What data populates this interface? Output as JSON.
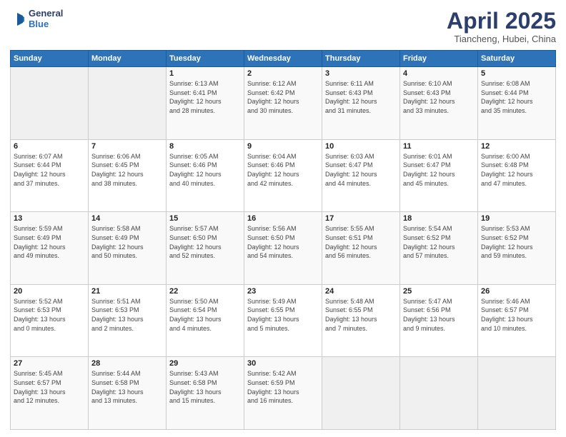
{
  "header": {
    "logo_line1": "General",
    "logo_line2": "Blue",
    "month": "April 2025",
    "location": "Tiancheng, Hubei, China"
  },
  "weekdays": [
    "Sunday",
    "Monday",
    "Tuesday",
    "Wednesday",
    "Thursday",
    "Friday",
    "Saturday"
  ],
  "weeks": [
    [
      {
        "day": "",
        "info": ""
      },
      {
        "day": "",
        "info": ""
      },
      {
        "day": "1",
        "info": "Sunrise: 6:13 AM\nSunset: 6:41 PM\nDaylight: 12 hours\nand 28 minutes."
      },
      {
        "day": "2",
        "info": "Sunrise: 6:12 AM\nSunset: 6:42 PM\nDaylight: 12 hours\nand 30 minutes."
      },
      {
        "day": "3",
        "info": "Sunrise: 6:11 AM\nSunset: 6:43 PM\nDaylight: 12 hours\nand 31 minutes."
      },
      {
        "day": "4",
        "info": "Sunrise: 6:10 AM\nSunset: 6:43 PM\nDaylight: 12 hours\nand 33 minutes."
      },
      {
        "day": "5",
        "info": "Sunrise: 6:08 AM\nSunset: 6:44 PM\nDaylight: 12 hours\nand 35 minutes."
      }
    ],
    [
      {
        "day": "6",
        "info": "Sunrise: 6:07 AM\nSunset: 6:44 PM\nDaylight: 12 hours\nand 37 minutes."
      },
      {
        "day": "7",
        "info": "Sunrise: 6:06 AM\nSunset: 6:45 PM\nDaylight: 12 hours\nand 38 minutes."
      },
      {
        "day": "8",
        "info": "Sunrise: 6:05 AM\nSunset: 6:46 PM\nDaylight: 12 hours\nand 40 minutes."
      },
      {
        "day": "9",
        "info": "Sunrise: 6:04 AM\nSunset: 6:46 PM\nDaylight: 12 hours\nand 42 minutes."
      },
      {
        "day": "10",
        "info": "Sunrise: 6:03 AM\nSunset: 6:47 PM\nDaylight: 12 hours\nand 44 minutes."
      },
      {
        "day": "11",
        "info": "Sunrise: 6:01 AM\nSunset: 6:47 PM\nDaylight: 12 hours\nand 45 minutes."
      },
      {
        "day": "12",
        "info": "Sunrise: 6:00 AM\nSunset: 6:48 PM\nDaylight: 12 hours\nand 47 minutes."
      }
    ],
    [
      {
        "day": "13",
        "info": "Sunrise: 5:59 AM\nSunset: 6:49 PM\nDaylight: 12 hours\nand 49 minutes."
      },
      {
        "day": "14",
        "info": "Sunrise: 5:58 AM\nSunset: 6:49 PM\nDaylight: 12 hours\nand 50 minutes."
      },
      {
        "day": "15",
        "info": "Sunrise: 5:57 AM\nSunset: 6:50 PM\nDaylight: 12 hours\nand 52 minutes."
      },
      {
        "day": "16",
        "info": "Sunrise: 5:56 AM\nSunset: 6:50 PM\nDaylight: 12 hours\nand 54 minutes."
      },
      {
        "day": "17",
        "info": "Sunrise: 5:55 AM\nSunset: 6:51 PM\nDaylight: 12 hours\nand 56 minutes."
      },
      {
        "day": "18",
        "info": "Sunrise: 5:54 AM\nSunset: 6:52 PM\nDaylight: 12 hours\nand 57 minutes."
      },
      {
        "day": "19",
        "info": "Sunrise: 5:53 AM\nSunset: 6:52 PM\nDaylight: 12 hours\nand 59 minutes."
      }
    ],
    [
      {
        "day": "20",
        "info": "Sunrise: 5:52 AM\nSunset: 6:53 PM\nDaylight: 13 hours\nand 0 minutes."
      },
      {
        "day": "21",
        "info": "Sunrise: 5:51 AM\nSunset: 6:53 PM\nDaylight: 13 hours\nand 2 minutes."
      },
      {
        "day": "22",
        "info": "Sunrise: 5:50 AM\nSunset: 6:54 PM\nDaylight: 13 hours\nand 4 minutes."
      },
      {
        "day": "23",
        "info": "Sunrise: 5:49 AM\nSunset: 6:55 PM\nDaylight: 13 hours\nand 5 minutes."
      },
      {
        "day": "24",
        "info": "Sunrise: 5:48 AM\nSunset: 6:55 PM\nDaylight: 13 hours\nand 7 minutes."
      },
      {
        "day": "25",
        "info": "Sunrise: 5:47 AM\nSunset: 6:56 PM\nDaylight: 13 hours\nand 9 minutes."
      },
      {
        "day": "26",
        "info": "Sunrise: 5:46 AM\nSunset: 6:57 PM\nDaylight: 13 hours\nand 10 minutes."
      }
    ],
    [
      {
        "day": "27",
        "info": "Sunrise: 5:45 AM\nSunset: 6:57 PM\nDaylight: 13 hours\nand 12 minutes."
      },
      {
        "day": "28",
        "info": "Sunrise: 5:44 AM\nSunset: 6:58 PM\nDaylight: 13 hours\nand 13 minutes."
      },
      {
        "day": "29",
        "info": "Sunrise: 5:43 AM\nSunset: 6:58 PM\nDaylight: 13 hours\nand 15 minutes."
      },
      {
        "day": "30",
        "info": "Sunrise: 5:42 AM\nSunset: 6:59 PM\nDaylight: 13 hours\nand 16 minutes."
      },
      {
        "day": "",
        "info": ""
      },
      {
        "day": "",
        "info": ""
      },
      {
        "day": "",
        "info": ""
      }
    ]
  ]
}
